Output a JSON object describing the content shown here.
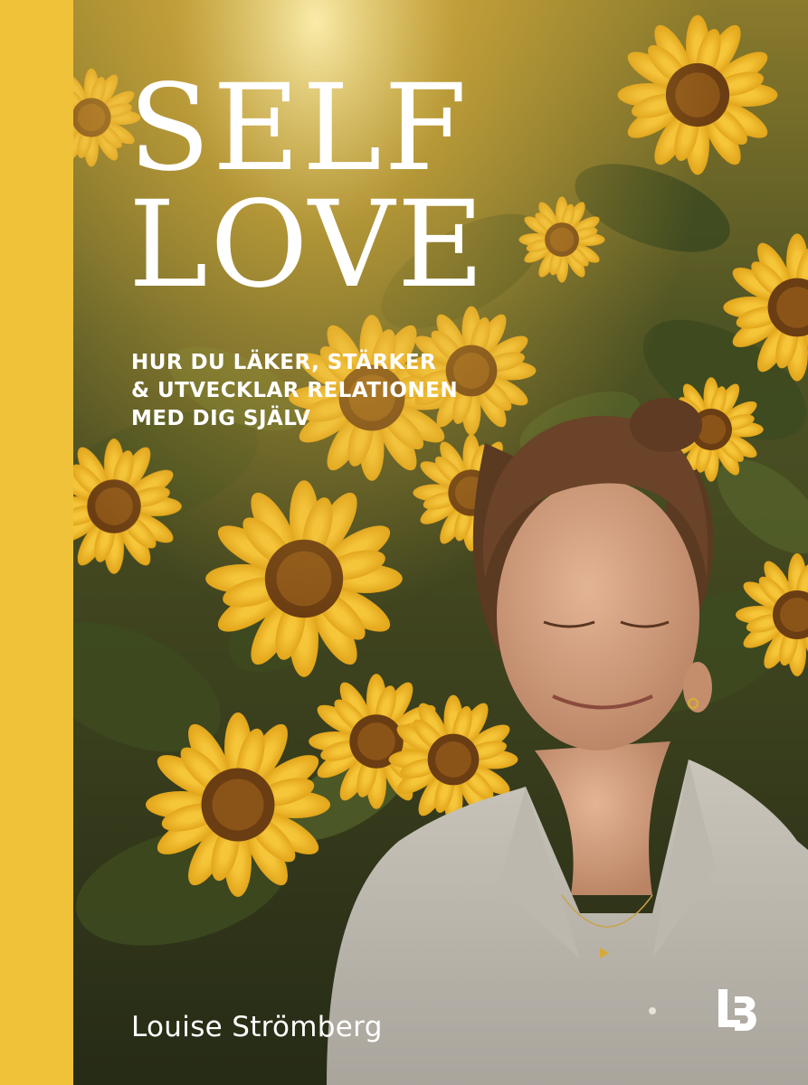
{
  "cover": {
    "title_line1": "SELF",
    "title_line2": "LOVE",
    "subtitle_lines": [
      "HUR DU LÄKER, STÄRKER",
      "& UTVECKLAR RELATIONEN",
      "MED DIG SJÄLV"
    ],
    "author": "Louise Strömberg",
    "publisher_logo": "LB"
  },
  "colors": {
    "spine": "#f0c23a",
    "text": "#ffffff"
  }
}
